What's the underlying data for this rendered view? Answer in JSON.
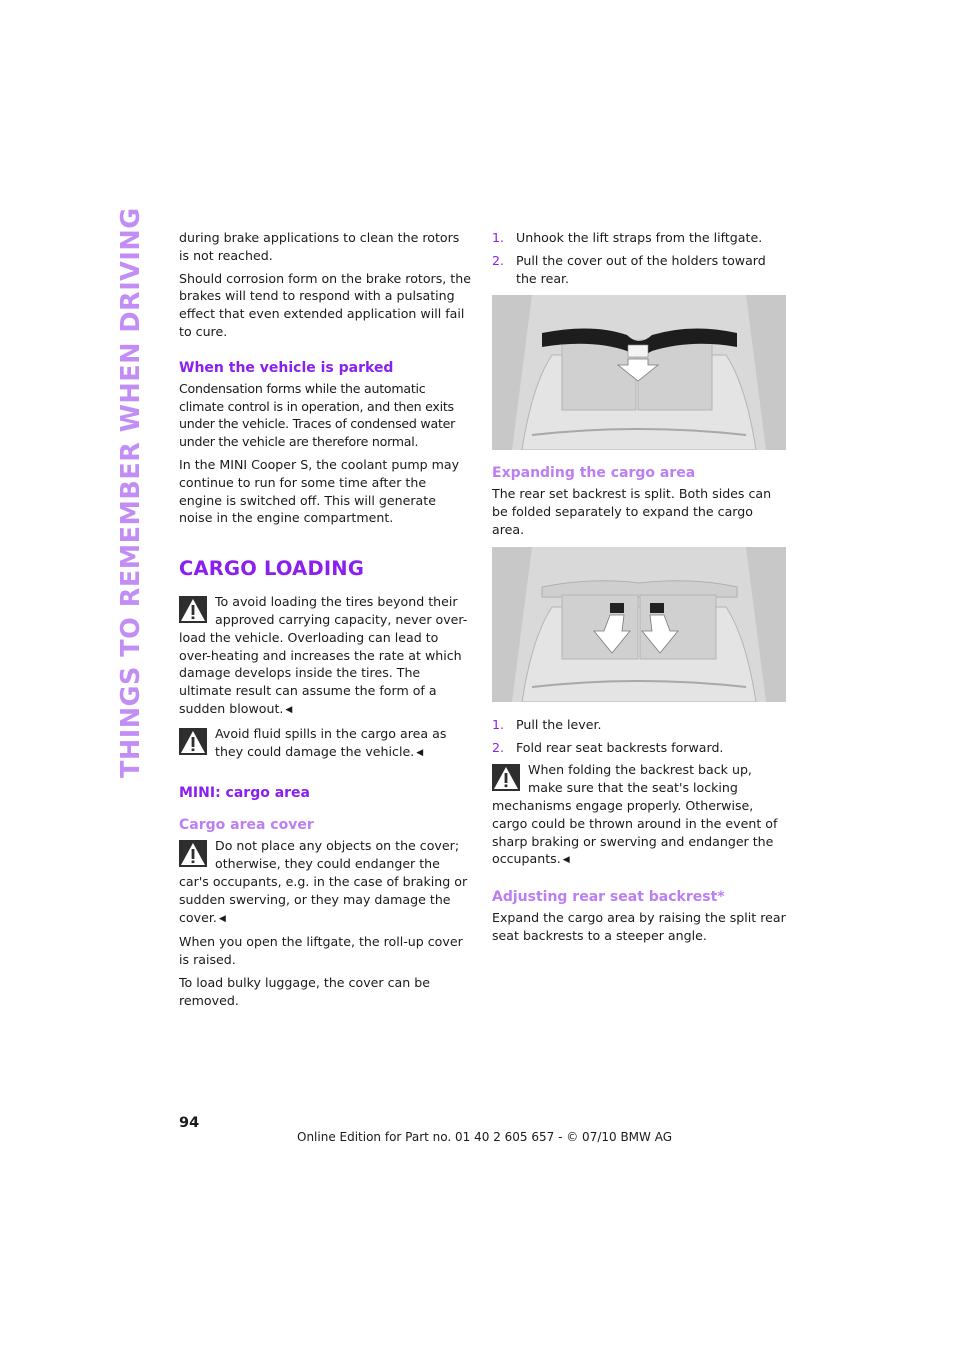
{
  "side_tab": "THINGS TO REMEMBER WHEN DRIVING",
  "left": {
    "p1": "during brake applications to clean the rotors is not reached.",
    "p2": "Should corrosion form on the brake rotors, the brakes will tend to respond with a pulsating effect that even extended application will fail to cure.",
    "parked_heading": "When the vehicle is parked",
    "p3": "Condensation forms while the automatic climate control is in operation, and then exits under the vehicle. Traces of condensed water under the vehicle are therefore normal.",
    "p4": "In the MINI Cooper S, the coolant pump may continue to run for some time after the engine is switched off. This will generate noise in the engine compartment.",
    "cargo_heading": "CARGO LOADING",
    "warning1": "To avoid loading the tires beyond their approved carrying capacity, never over-load the vehicle. Overloading can lead to over-heating and increases the rate at which damage develops inside the tires. The ultimate result can assume the form of a sudden blowout.",
    "warning2": "Avoid fluid spills in the cargo area as they could damage the vehicle.",
    "mini_heading": "MINI: cargo area",
    "cover_heading": "Cargo area cover",
    "warning3": "Do not place any objects on the cover; otherwise, they could endanger the car's occupants, e.g. in the case of braking or sudden swerving, or they may damage the cover.",
    "p5": "When you open the liftgate, the roll-up cover is raised.",
    "p6": "To load bulky luggage, the cover can be removed."
  },
  "right": {
    "steps1": [
      {
        "num": "1.",
        "text": "Unhook the lift straps from the liftgate."
      },
      {
        "num": "2.",
        "text": "Pull the cover out of the holders toward the rear."
      }
    ],
    "expand_heading": "Expanding the cargo area",
    "p1": "The rear set backrest is split. Both sides can be folded separately to expand the cargo area.",
    "steps2": [
      {
        "num": "1.",
        "text": "Pull the lever."
      },
      {
        "num": "2.",
        "text": "Fold rear seat backrests forward."
      }
    ],
    "warning4": "When folding the backrest back up, make sure that the seat's locking mechanisms engage properly. Otherwise, cargo could be thrown around in the event of sharp braking or swerving and endanger the occupants.",
    "adjust_heading": "Adjusting rear seat backrest*",
    "p2": "Expand the cargo area by raising the split rear seat backrests to a steeper angle."
  },
  "icons": {
    "warning": "warning-triangle-icon",
    "end_mark": "◀"
  },
  "colors": {
    "heading": "#8a1ff0",
    "subheading": "#bc7ff3",
    "side_tab": "#c28ef5"
  },
  "footer": {
    "page_number": "94",
    "edition": "Online Edition for Part no. 01 40 2 605 657 - © 07/10  BMW AG"
  }
}
